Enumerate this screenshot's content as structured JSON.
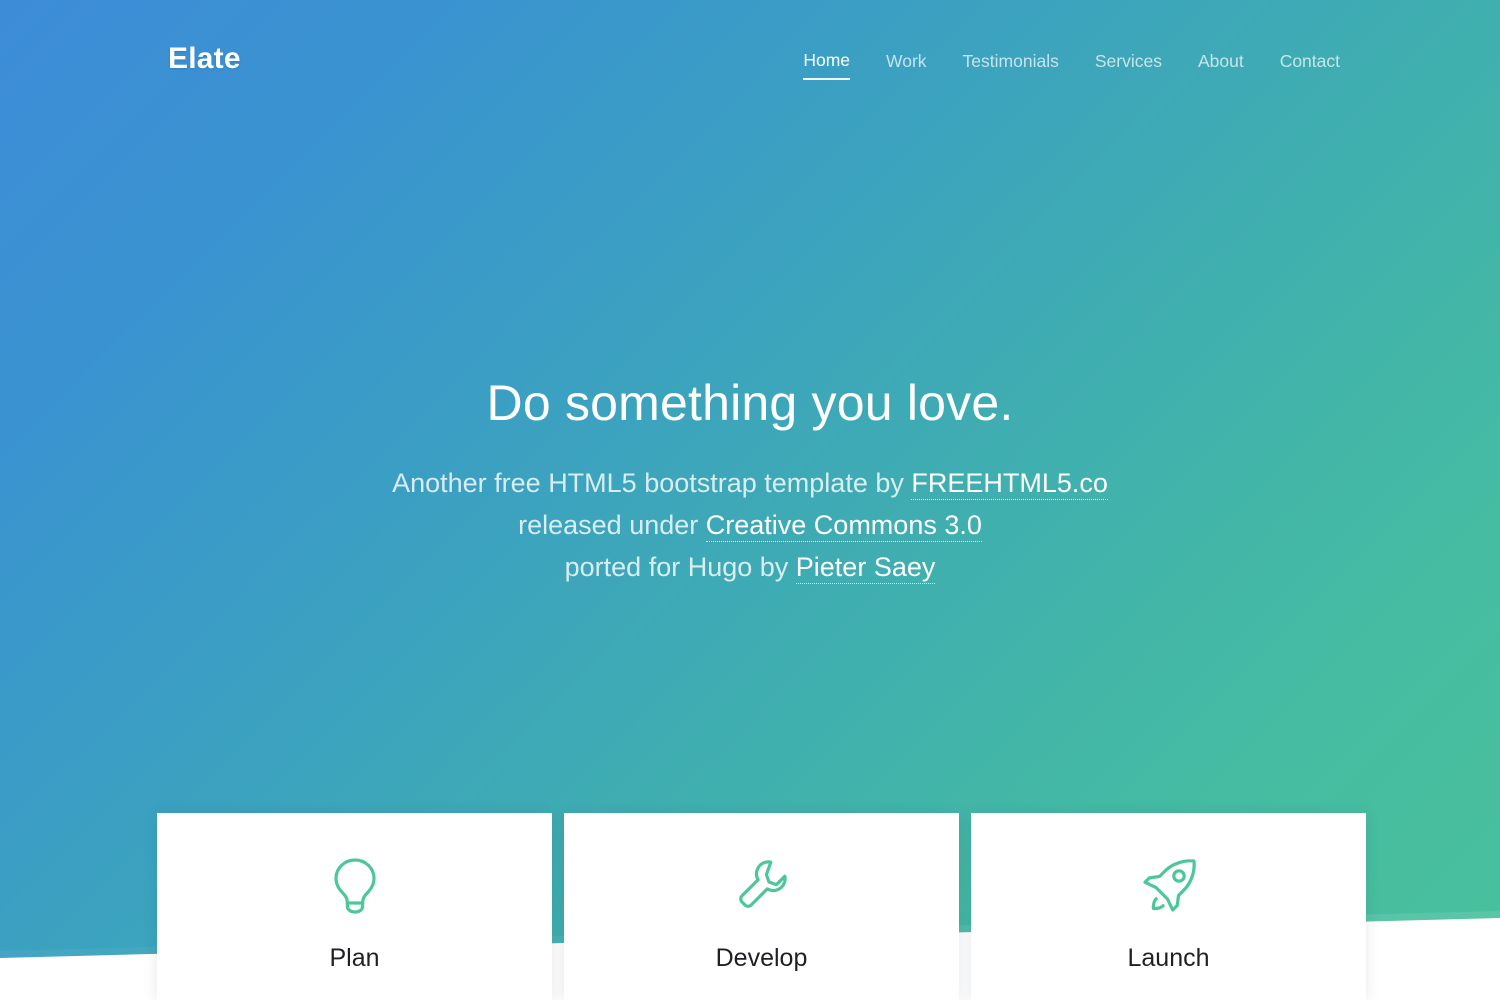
{
  "brand": {
    "logo": "Elate"
  },
  "nav": {
    "items": [
      {
        "label": "Home",
        "active": true
      },
      {
        "label": "Work",
        "active": false
      },
      {
        "label": "Testimonials",
        "active": false
      },
      {
        "label": "Services",
        "active": false
      },
      {
        "label": "About",
        "active": false
      },
      {
        "label": "Contact",
        "active": false
      }
    ]
  },
  "hero": {
    "title": "Do something you love.",
    "line1_pre": "Another free HTML5 bootstrap template by ",
    "line1_link": "FREEHTML5.co",
    "line2_pre": "released under ",
    "line2_link": "Creative Commons 3.0",
    "line3_pre": "ported for Hugo by ",
    "line3_link": "Pieter Saey"
  },
  "cards": [
    {
      "label": "Plan",
      "icon": "lightbulb-icon"
    },
    {
      "label": "Develop",
      "icon": "wrench-icon"
    },
    {
      "label": "Launch",
      "icon": "rocket-icon"
    }
  ],
  "colors": {
    "gradient_start": "#3d8cd8",
    "gradient_mid": "#3ba0c2",
    "gradient_end": "#49c09c",
    "icon_green": "#4cc79a",
    "card_bg": "#ffffff",
    "label_text": "#1f2023"
  }
}
